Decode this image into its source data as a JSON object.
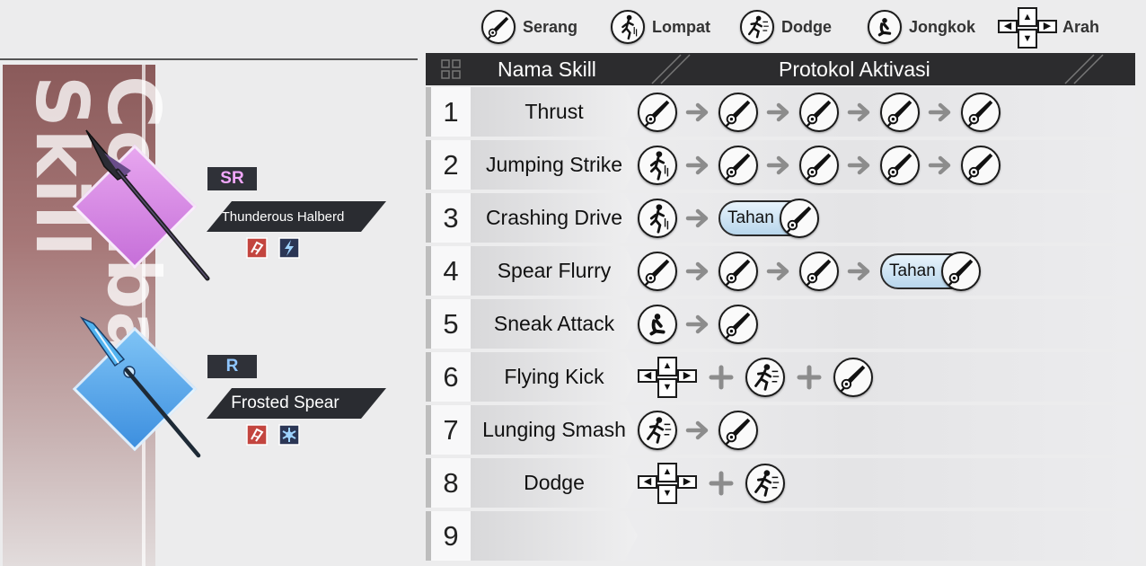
{
  "legend": {
    "items": [
      {
        "icon": "attack-icon",
        "label": "Serang"
      },
      {
        "icon": "jump-icon",
        "label": "Lompat"
      },
      {
        "icon": "dodge-icon",
        "label": "Dodge"
      },
      {
        "icon": "crouch-icon",
        "label": "Jongkok"
      },
      {
        "icon": "direction-pad-icon",
        "label": "Arah"
      }
    ]
  },
  "side_panel": {
    "title": "Combat Skill"
  },
  "weapons": [
    {
      "rarity": "SR",
      "name": "Thunderous Halberd",
      "accent": "#c66fd9",
      "elements": [
        "slash-element-icon",
        "lightning-element-icon"
      ]
    },
    {
      "rarity": "R",
      "name": "Frosted Spear",
      "accent": "#3d8fdf",
      "elements": [
        "slash-element-icon",
        "frost-element-icon"
      ]
    }
  ],
  "table": {
    "col_name": "Nama Skill",
    "col_protocol": "Protokol Aktivasi",
    "rows": [
      {
        "num": "1",
        "name": "Thrust",
        "sequence": [
          "attack",
          "arrow",
          "attack",
          "arrow",
          "attack",
          "arrow",
          "attack",
          "arrow",
          "attack"
        ]
      },
      {
        "num": "2",
        "name": "Jumping Strike",
        "sequence": [
          "jump",
          "arrow",
          "attack",
          "arrow",
          "attack",
          "arrow",
          "attack",
          "arrow",
          "attack"
        ]
      },
      {
        "num": "3",
        "name": "Crashing Drive",
        "sequence": [
          "jump",
          "arrow",
          "hold-attack"
        ]
      },
      {
        "num": "4",
        "name": "Spear Flurry",
        "sequence": [
          "attack",
          "arrow",
          "attack",
          "arrow",
          "attack",
          "arrow",
          "hold-attack"
        ]
      },
      {
        "num": "5",
        "name": "Sneak Attack",
        "sequence": [
          "crouch",
          "arrow",
          "attack"
        ]
      },
      {
        "num": "6",
        "name": "Flying Kick",
        "sequence": [
          "dpad",
          "plus",
          "dodge",
          "plus",
          "attack"
        ]
      },
      {
        "num": "7",
        "name": "Lunging Smash",
        "sequence": [
          "dodge",
          "arrow",
          "attack"
        ]
      },
      {
        "num": "8",
        "name": "Dodge",
        "sequence": [
          "dpad",
          "plus",
          "dodge"
        ]
      },
      {
        "num": "9",
        "name": "",
        "sequence": []
      }
    ],
    "hold_label": "Tahan"
  },
  "colors": {
    "header_bg": "#2c2c2e",
    "hold_fill": "#b8d6ec",
    "sr_color": "#f2a8ff",
    "r_color": "#8fc6ff"
  }
}
